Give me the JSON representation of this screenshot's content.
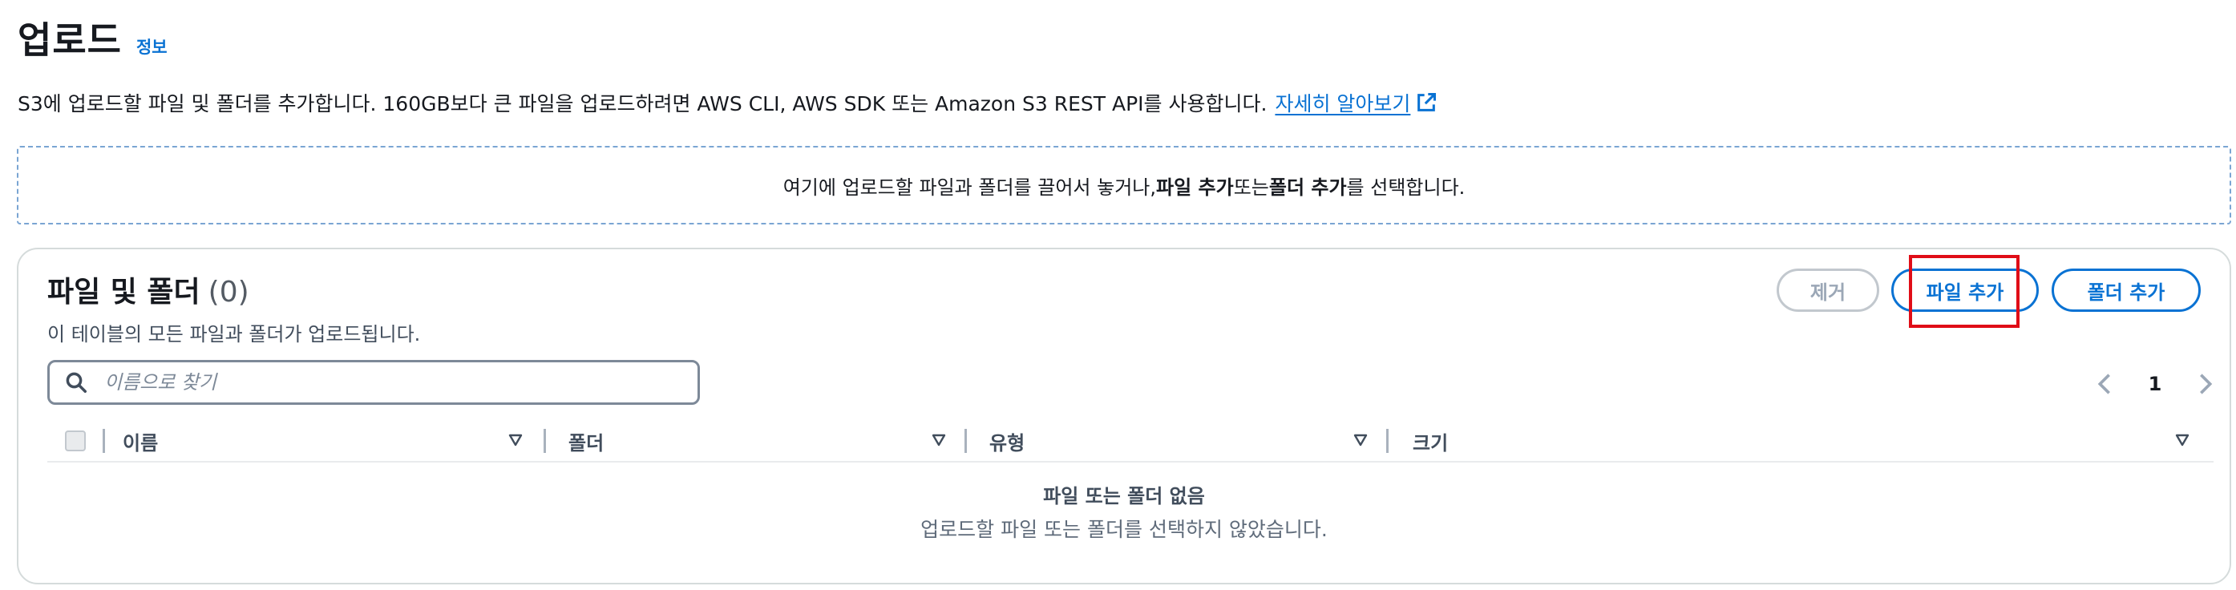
{
  "header": {
    "title": "업로드",
    "info_link": "정보"
  },
  "description": {
    "text": "S3에 업로드할 파일 및 폴더를 추가합니다. 160GB보다 큰 파일을 업로드하려면 AWS CLI, AWS SDK 또는 Amazon S3 REST API를 사용합니다.",
    "learn_more": "자세히 알아보기",
    "learn_more_icon": "external-link-icon"
  },
  "dropzone": {
    "prefix": "여기에 업로드할 파일과 폴더를 끌어서 놓거나, ",
    "add_files": "파일 추가",
    "middle": " 또는 ",
    "add_folder": "폴더 추가",
    "suffix": "를 선택합니다."
  },
  "files_table": {
    "title": "파일 및 폴더",
    "count": "(0)",
    "description": "이 테이블의 모든 파일과 폴더가 업로드됩니다.",
    "buttons": {
      "remove": "제거",
      "add_files": "파일 추가",
      "add_folder": "폴더 추가"
    },
    "search": {
      "placeholder": "이름으로 찾기",
      "value": "",
      "icon": "search-icon"
    },
    "pagination": {
      "current_page": "1",
      "prev_icon": "chevron-left-icon",
      "next_icon": "chevron-right-icon"
    },
    "columns": [
      "이름",
      "폴더",
      "유형",
      "크기"
    ],
    "empty_state": {
      "title": "파일 또는 폴더 없음",
      "description": "업로드할 파일 또는 폴더를 선택하지 않았습니다."
    }
  },
  "colors": {
    "link": "#0972d3",
    "highlight": "#e00d17",
    "disabled": "#9ba7b6",
    "text": "#16191f"
  }
}
